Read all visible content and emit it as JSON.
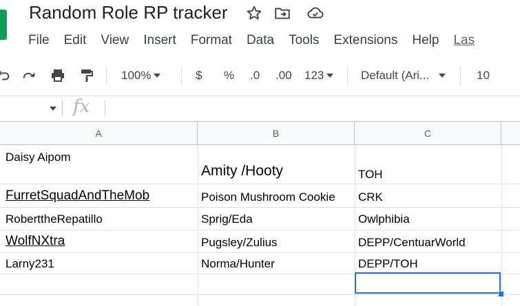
{
  "header": {
    "title": "Random Role RP tracker",
    "icons": [
      "star-icon",
      "move-to-folder-icon",
      "cloud-saved-icon"
    ]
  },
  "menu": {
    "items": [
      "File",
      "Edit",
      "View",
      "Insert",
      "Format",
      "Data",
      "Tools",
      "Extensions",
      "Help"
    ],
    "last_edit": "Las"
  },
  "toolbar": {
    "zoom": "100%",
    "currency": "$",
    "percent": "%",
    "decrease_decimal": ".0",
    "increase_decimal": ".00",
    "number_format": "123",
    "font": "Default (Ari...",
    "font_size": "10"
  },
  "formula_bar": {
    "fx": "fx",
    "value": ""
  },
  "sheet": {
    "columns": [
      "A",
      "B",
      "C"
    ],
    "rows": [
      [
        "Daisy Aipom",
        "Amity /Hooty",
        "TOH"
      ],
      [
        "FurretSquadAndTheMob",
        "Poison Mushroom Cookie",
        "CRK"
      ],
      [
        "RoberttheRepatillo",
        "Sprig/Eda",
        "Owlphibia"
      ],
      [
        "WolfNXtra",
        "Pugsley/Zulius",
        "DEPP/CentuarWorld"
      ],
      [
        "Larny231",
        "Norma/Hunter",
        "DEPP/TOH"
      ]
    ]
  },
  "colors": {
    "selection": "#1a73e8",
    "brand": "#0f9d58"
  }
}
